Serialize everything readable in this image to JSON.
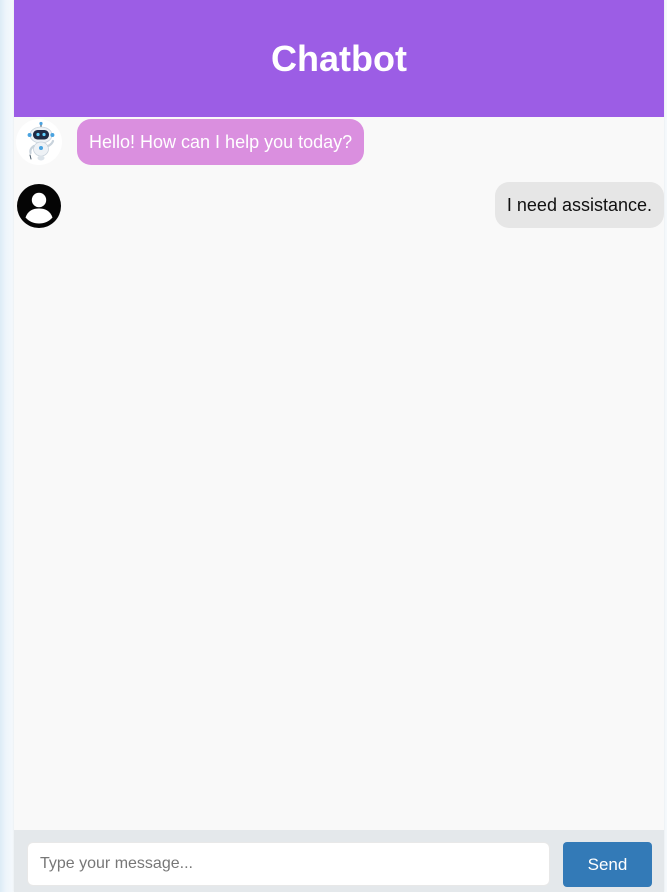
{
  "header": {
    "title": "Chatbot",
    "background_color": "#9c5de5"
  },
  "messages": [
    {
      "sender": "bot",
      "text": "Hello! How can I help you today?",
      "avatar_icon": "robot-icon",
      "bubble_color": "#da8fdf"
    },
    {
      "sender": "user",
      "text": "I need assistance.",
      "avatar_icon": "user-avatar-icon",
      "bubble_color": "#e6e6e6"
    }
  ],
  "input": {
    "placeholder": "Type your message...",
    "value": ""
  },
  "send_button": {
    "label": "Send",
    "color": "#337ab7"
  }
}
